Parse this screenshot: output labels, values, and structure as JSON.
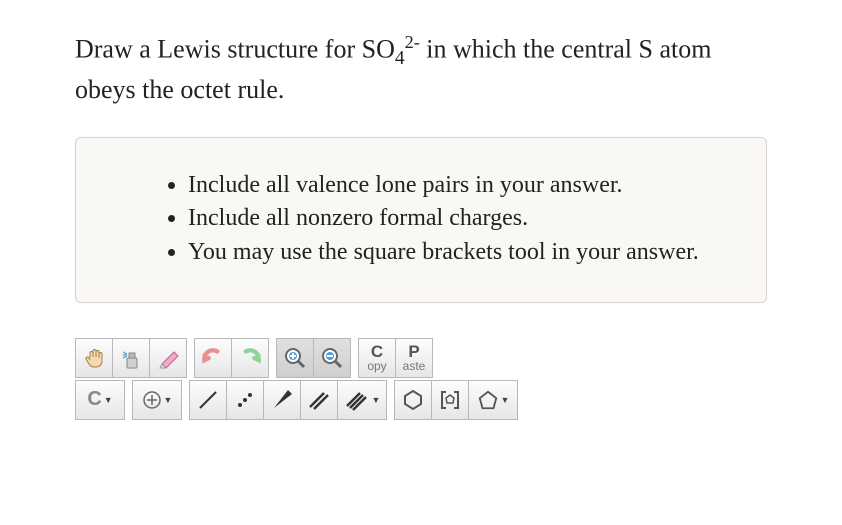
{
  "question": {
    "prefix": "Draw a Lewis structure for ",
    "formula_base": "SO",
    "formula_sub": "4",
    "formula_sup": "2-",
    "suffix": " in which the central S atom obeys the octet rule."
  },
  "instructions": [
    "Include all valence lone pairs in your answer.",
    "Include all nonzero formal charges.",
    "You may use the square brackets tool in your answer."
  ],
  "toolbar1": {
    "hand": "hand-tool",
    "spray": "spray-tool",
    "eraser": "eraser-tool",
    "undo": "undo",
    "redo": "redo",
    "zoom_in": "zoom-in",
    "zoom_out": "zoom-out",
    "copy_top": "C",
    "copy_bottom": "opy",
    "paste_top": "P",
    "paste_bottom": "aste"
  },
  "toolbar2": {
    "element_label": "C",
    "plus": "add-charge",
    "bond_single": "single-bond",
    "lone_pair": "lone-pair",
    "wedge": "wedge-bond",
    "double": "double-bond",
    "triple": "triple-bond",
    "ring1": "ring",
    "brackets": "brackets",
    "ring2": "polygon"
  }
}
